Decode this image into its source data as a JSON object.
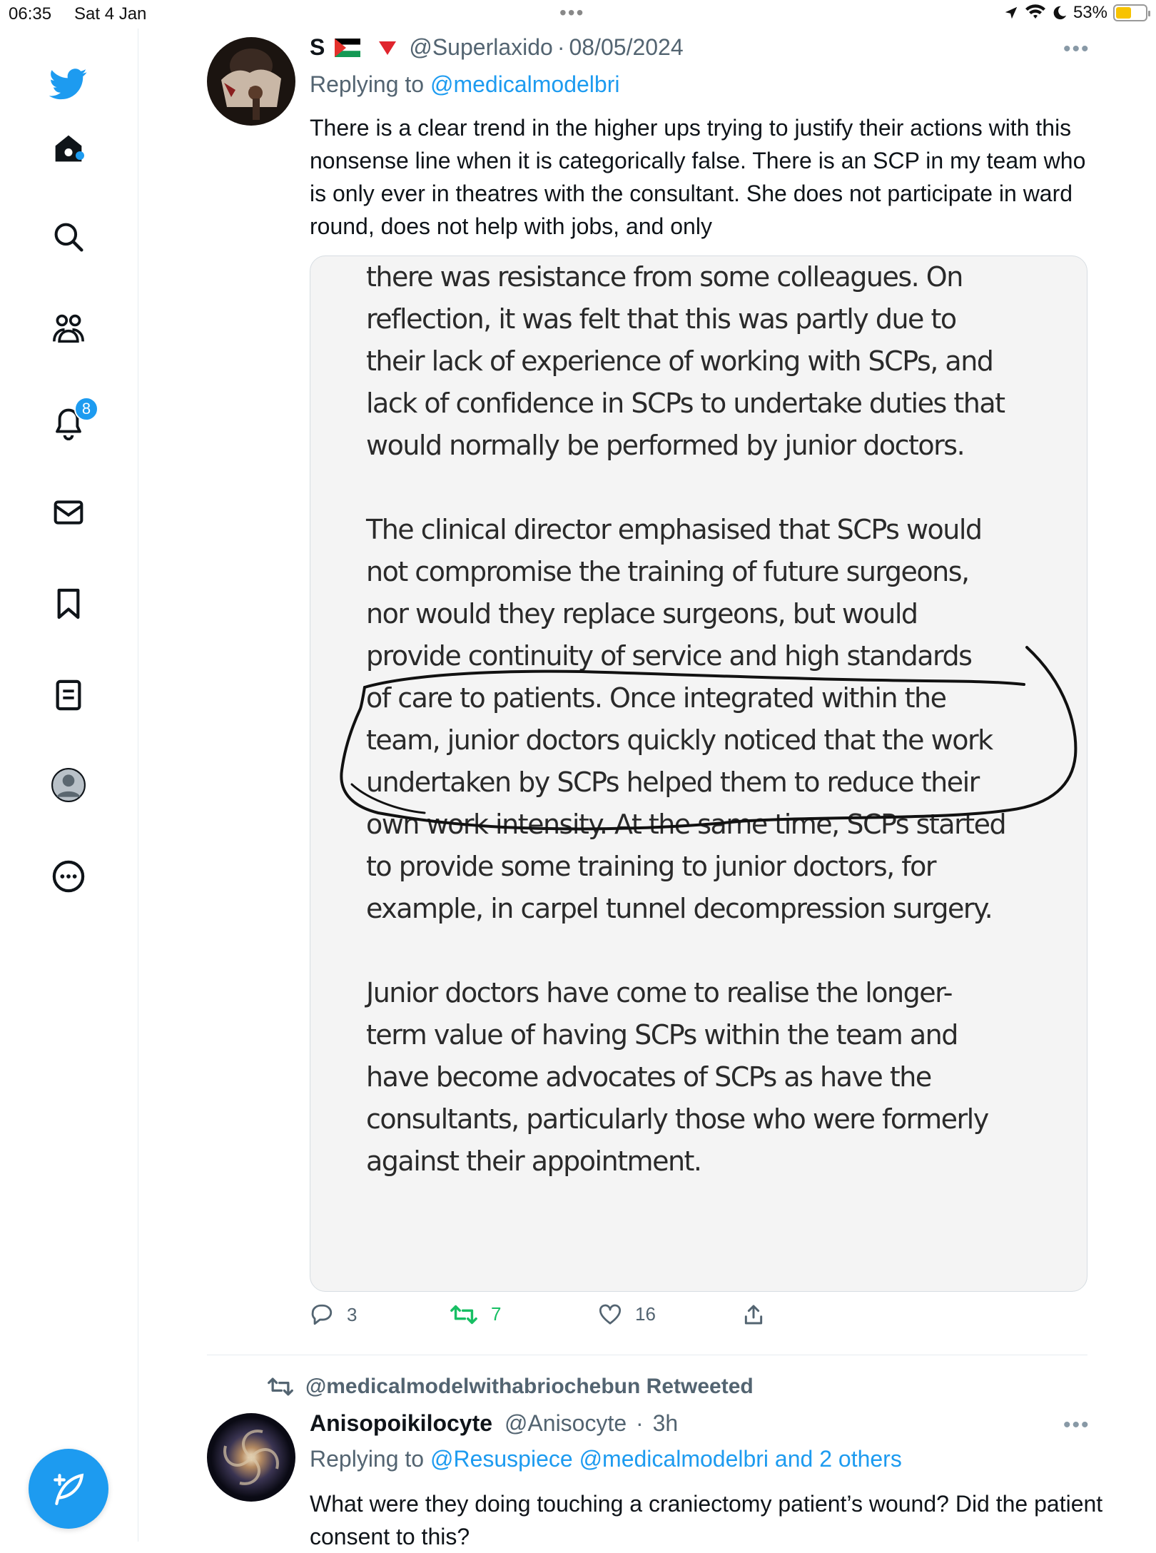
{
  "status_bar": {
    "time": "06:35",
    "date": "Sat 4 Jan",
    "battery": "53%",
    "battery_level": 0.53
  },
  "sidebar": {
    "notification_count": "8",
    "items": [
      "twitter-logo",
      "home",
      "explore",
      "communities",
      "notifications",
      "messages",
      "bookmarks",
      "lists",
      "profile",
      "more"
    ]
  },
  "tweet": {
    "display_name": "S",
    "handle": "@Superlaxido",
    "separator": "·",
    "date": "08/05/2024",
    "replying_prefix": "Replying to",
    "replying_to": "@medicalmodelbri",
    "text": "There is a clear trend in the higher ups trying to justify their actions with this nonsense line when it is categorically false. There is an SCP in my team who is only ever in theatres with the consultant. She does not participate in ward round, does not help with jobs, and only",
    "image_text": "there was resistance from some colleagues. On\nreflection, it was felt that this was partly due to\ntheir lack of experience of working with SCPs, and\nlack of confidence in SCPs to undertake duties that\nwould normally be performed by junior doctors.\n\nThe clinical director emphasised that SCPs would\nnot compromise the training of future surgeons,\nnor would they replace surgeons, but would\nprovide continuity of service and high standards\nof care to patients. Once integrated within the\nteam, junior doctors quickly noticed that the work\nundertaken by SCPs helped them to reduce their\nown work intensity. At the same time, SCPs started\nto provide some training to junior doctors, for\nexample, in carpel tunnel decompression surgery.\n\nJunior doctors have come to realise the longer-\nterm value of having SCPs within the team and\nhave become advocates of SCPs as have the\nconsultants, particularly those who were formerly\nagainst their appointment.",
    "replies": "3",
    "retweets": "7",
    "likes": "16"
  },
  "retweet_context": {
    "text": "@medicalmodelwithabriochebun Retweeted"
  },
  "tweet2": {
    "display_name": "Anisopoikilocyte",
    "handle": "@Anisocyte",
    "separator": "·",
    "time": "3h",
    "replying_prefix": "Replying to",
    "replying_to": "@Resuspiece @medicalmodelbri and 2 others",
    "text": "What were they doing touching a craniectomy patient’s wound? Did the patient consent to this?"
  },
  "colors": {
    "accent": "#1d9bf0",
    "retweet_green": "#17bf63",
    "muted": "#536471"
  }
}
